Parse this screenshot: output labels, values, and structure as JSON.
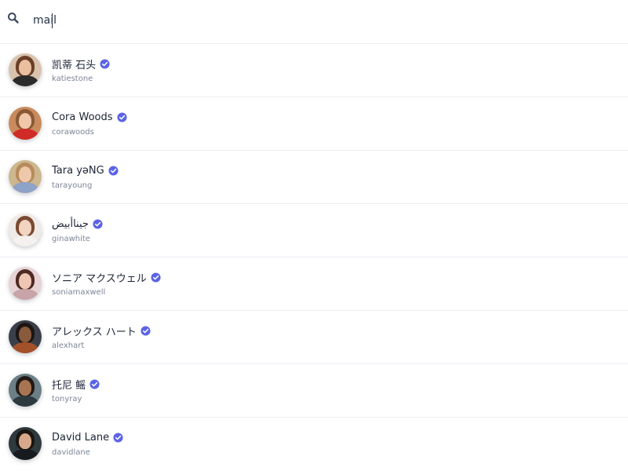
{
  "search": {
    "value": "mail",
    "icon": "search-icon"
  },
  "colors": {
    "verified": "#5b63e6",
    "name_text": "#1c2436",
    "handle_text": "#7b8697",
    "divider": "#e9ecf1"
  },
  "results": [
    {
      "name": "凯蒂 石头",
      "handle": "katiestone",
      "verified": true
    },
    {
      "name": "Cora Woods",
      "handle": "corawoods",
      "verified": true
    },
    {
      "name": "Tara yəNG",
      "handle": "tarayoung",
      "verified": true
    },
    {
      "name": "جيناأبيض",
      "handle": "ginawhite",
      "verified": true
    },
    {
      "name": "ソニア マクスウェル",
      "handle": "soniamaxwell",
      "verified": true
    },
    {
      "name": "アレックス ハート",
      "handle": "alexhart",
      "verified": true
    },
    {
      "name": "托尼 鳐",
      "handle": "tonyray",
      "verified": true
    },
    {
      "name": "David Lane",
      "handle": "davidlane",
      "verified": true
    }
  ]
}
